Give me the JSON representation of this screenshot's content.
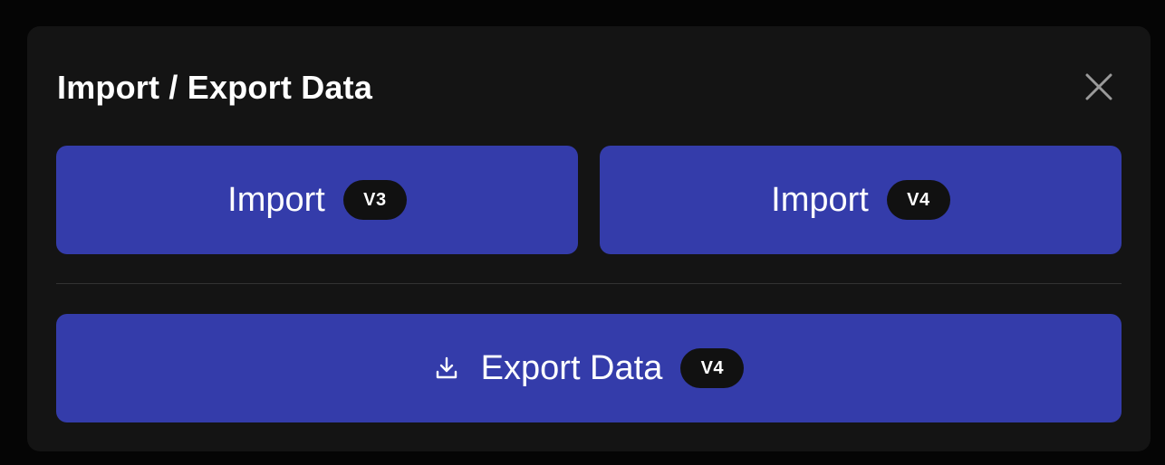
{
  "modal": {
    "title": "Import / Export Data",
    "close_icon": "close-icon"
  },
  "buttons": {
    "import_v3": {
      "label": "Import",
      "badge": "V3"
    },
    "import_v4": {
      "label": "Import",
      "badge": "V4"
    },
    "export": {
      "label": "Export Data",
      "badge": "V4",
      "icon": "download-icon"
    }
  },
  "colors": {
    "modal_background": "#141414",
    "button_background": "#343caa",
    "badge_background": "#111111",
    "text": "#ffffff",
    "close_icon": "#9a9a9a",
    "divider": "#333333"
  }
}
